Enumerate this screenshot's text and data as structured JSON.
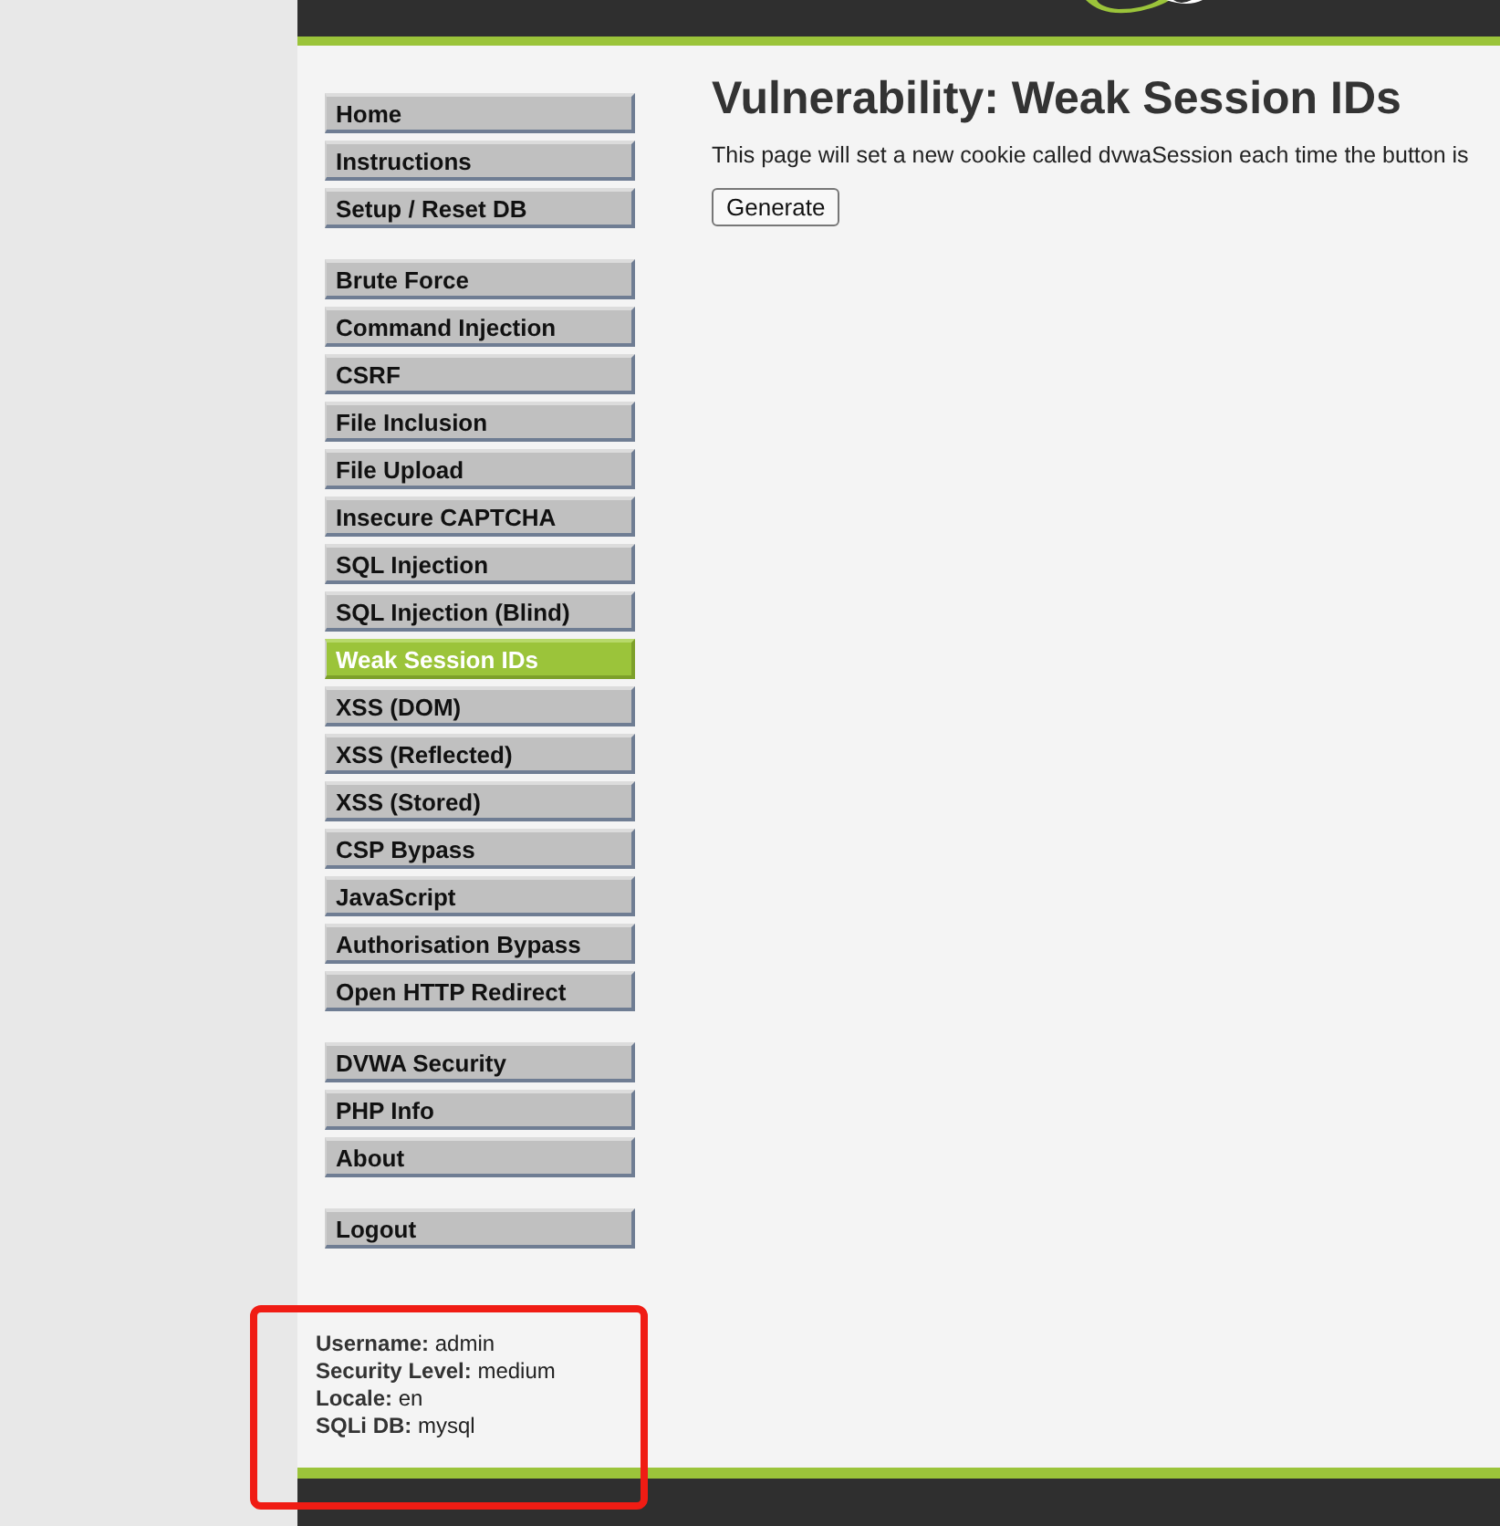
{
  "menu": [
    {
      "items": [
        {
          "label": "Home",
          "selected": false
        },
        {
          "label": "Instructions",
          "selected": false
        },
        {
          "label": "Setup / Reset DB",
          "selected": false
        }
      ]
    },
    {
      "items": [
        {
          "label": "Brute Force",
          "selected": false
        },
        {
          "label": "Command Injection",
          "selected": false
        },
        {
          "label": "CSRF",
          "selected": false
        },
        {
          "label": "File Inclusion",
          "selected": false
        },
        {
          "label": "File Upload",
          "selected": false
        },
        {
          "label": "Insecure CAPTCHA",
          "selected": false
        },
        {
          "label": "SQL Injection",
          "selected": false
        },
        {
          "label": "SQL Injection (Blind)",
          "selected": false
        },
        {
          "label": "Weak Session IDs",
          "selected": true
        },
        {
          "label": "XSS (DOM)",
          "selected": false
        },
        {
          "label": "XSS (Reflected)",
          "selected": false
        },
        {
          "label": "XSS (Stored)",
          "selected": false
        },
        {
          "label": "CSP Bypass",
          "selected": false
        },
        {
          "label": "JavaScript",
          "selected": false
        },
        {
          "label": "Authorisation Bypass",
          "selected": false
        },
        {
          "label": "Open HTTP Redirect",
          "selected": false
        }
      ]
    },
    {
      "items": [
        {
          "label": "DVWA Security",
          "selected": false
        },
        {
          "label": "PHP Info",
          "selected": false
        },
        {
          "label": "About",
          "selected": false
        }
      ]
    },
    {
      "items": [
        {
          "label": "Logout",
          "selected": false
        }
      ]
    }
  ],
  "page": {
    "title": "Vulnerability: Weak Session IDs",
    "description": "This page will set a new cookie called dvwaSession each time the button is",
    "button": "Generate"
  },
  "user_info": [
    {
      "label": "Username:",
      "value": "admin"
    },
    {
      "label": "Security Level:",
      "value": "medium"
    },
    {
      "label": "Locale:",
      "value": "en"
    },
    {
      "label": "SQLi DB:",
      "value": "mysql"
    }
  ]
}
